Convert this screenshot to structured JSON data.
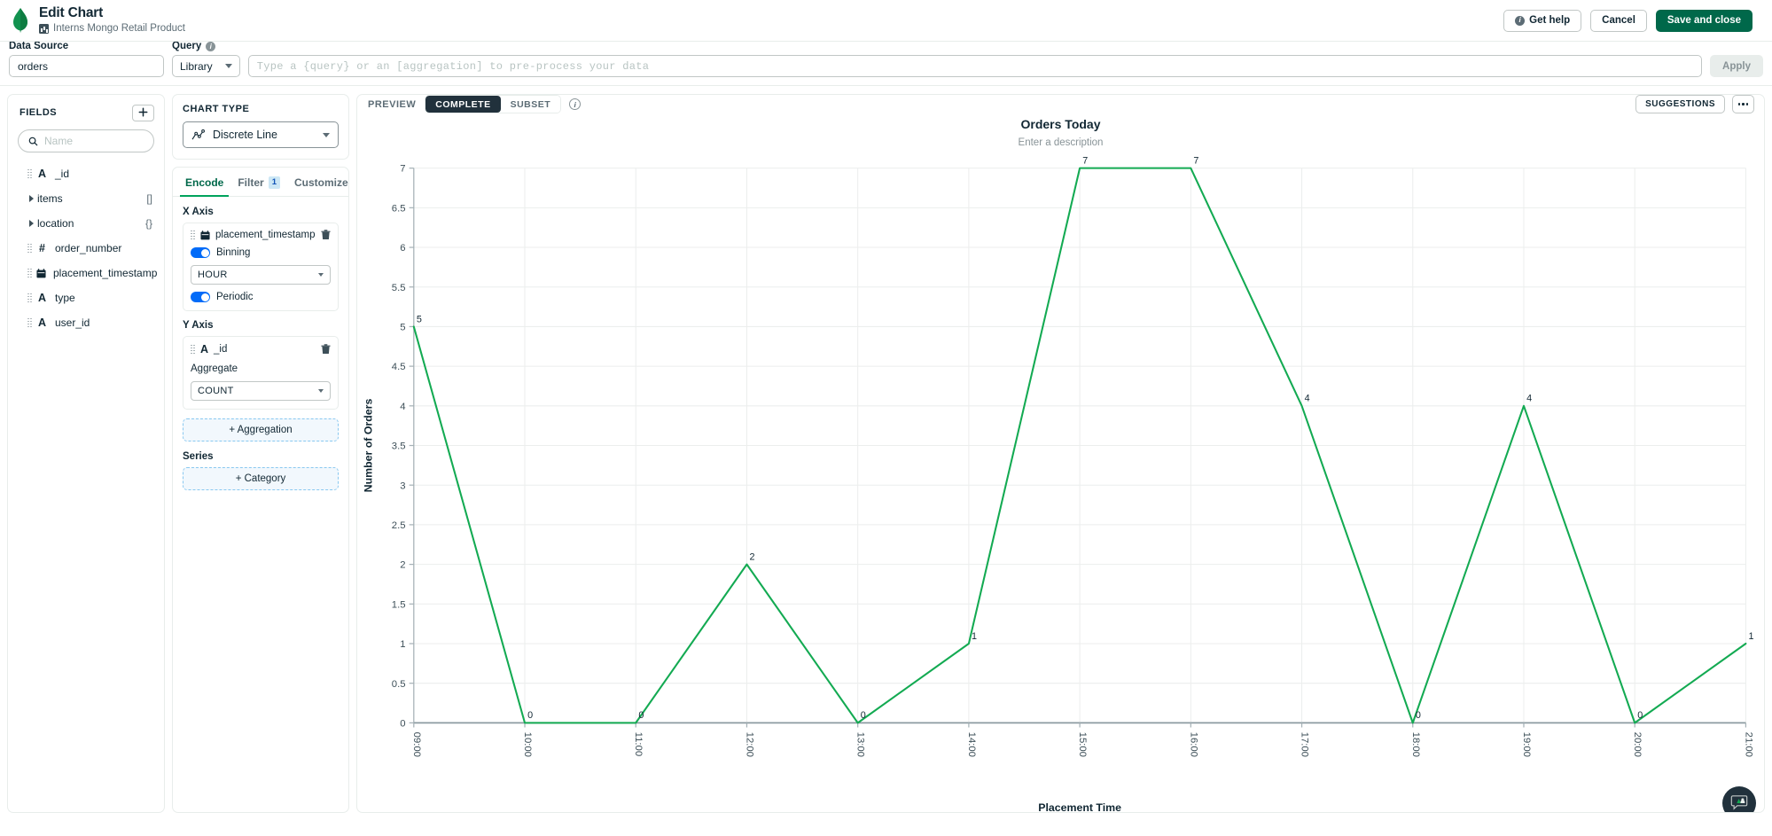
{
  "topbar": {
    "logo_icon": "mongodb-leaf-icon",
    "title": "Edit Chart",
    "dashboard_icon": "chart-badge-icon",
    "dashboard_name": "Interns Mongo Retail Product",
    "get_help_label": "Get help",
    "cancel_label": "Cancel",
    "save_label": "Save and close"
  },
  "querybar": {
    "data_source_label": "Data Source",
    "data_source_value": "orders",
    "query_label": "Query",
    "query_info_icon": "info-icon",
    "library_label": "Library",
    "query_placeholder": "Type a {query} or an [aggregation] to pre-process your data",
    "apply_label": "Apply"
  },
  "fields": {
    "title": "FIELDS",
    "add_icon": "plus-icon",
    "search_icon": "search-icon",
    "search_placeholder": "Name",
    "items": [
      {
        "name": "_id",
        "type_glyph": "A",
        "kind": "string",
        "suffix": "",
        "expandable": false
      },
      {
        "name": "items",
        "type_glyph": "",
        "kind": "array",
        "suffix": "[]",
        "expandable": true
      },
      {
        "name": "location",
        "type_glyph": "",
        "kind": "object",
        "suffix": "{}",
        "expandable": true
      },
      {
        "name": "order_number",
        "type_glyph": "#",
        "kind": "number",
        "suffix": "",
        "expandable": false
      },
      {
        "name": "placement_timestamp",
        "type_glyph": "cal",
        "kind": "date",
        "suffix": "",
        "expandable": false
      },
      {
        "name": "type",
        "type_glyph": "A",
        "kind": "string",
        "suffix": "",
        "expandable": false
      },
      {
        "name": "user_id",
        "type_glyph": "A",
        "kind": "string",
        "suffix": "",
        "expandable": false
      }
    ]
  },
  "encode": {
    "chart_type_label": "CHART TYPE",
    "chart_type_icon": "line-chart-icon",
    "chart_type_value": "Discrete Line",
    "tabs": [
      {
        "label": "Encode",
        "active": true,
        "badge": ""
      },
      {
        "label": "Filter",
        "active": false,
        "badge": "1"
      },
      {
        "label": "Customize",
        "active": false,
        "badge": ""
      }
    ],
    "x_axis": {
      "label": "X Axis",
      "field_icon": "calendar-icon",
      "field_name": "placement_timestamp",
      "delete_icon": "trash-icon",
      "binning_label": "Binning",
      "binning_on": true,
      "bin_unit": "HOUR",
      "periodic_label": "Periodic",
      "periodic_on": true
    },
    "y_axis": {
      "label": "Y Axis",
      "field_icon": "string-type-icon",
      "field_name": "_id",
      "delete_icon": "trash-icon",
      "aggregate_label": "Aggregate",
      "aggregate_value": "COUNT",
      "add_aggregation_label": "+ Aggregation"
    },
    "series": {
      "label": "Series",
      "add_category_label": "+ Category"
    }
  },
  "chart_toolbar": {
    "preview_label": "PREVIEW",
    "segments": [
      {
        "label": "COMPLETE",
        "active": true
      },
      {
        "label": "SUBSET",
        "active": false
      }
    ],
    "info_icon": "info-icon",
    "suggestions_label": "SUGGESTIONS",
    "more_icon": "ellipsis-icon"
  },
  "chat": {
    "icon": "chat-feedback-icon"
  },
  "colors": {
    "brand_green": "#00684a",
    "line_green": "#13aa52",
    "accent": "#00a35c",
    "dark": "#21313c",
    "toggle_blue": "#016bf8"
  },
  "chart_data": {
    "type": "line",
    "title": "Orders Today",
    "subtitle": "Enter a description",
    "xlabel": "Placement Time",
    "ylabel": "Number of Orders",
    "categories": [
      "09:00",
      "10:00",
      "11:00",
      "12:00",
      "13:00",
      "14:00",
      "15:00",
      "16:00",
      "17:00",
      "18:00",
      "19:00",
      "20:00",
      "21:00"
    ],
    "values": [
      5,
      0,
      0,
      2,
      0,
      1,
      7,
      7,
      4,
      0,
      4,
      0,
      1
    ],
    "data_labels": [
      "5",
      "0",
      "0",
      "2",
      "0",
      "1",
      "7",
      "7",
      "4",
      "0",
      "4",
      "0",
      "1"
    ],
    "ylim": [
      0,
      7
    ],
    "yticks": [
      0,
      0.5,
      1,
      1.5,
      2,
      2.5,
      3,
      3.5,
      4,
      4.5,
      5,
      5.5,
      6,
      6.5,
      7
    ],
    "ytick_labels": [
      "0",
      "0.5",
      "1",
      "1.5",
      "2",
      "2.5",
      "3",
      "3.5",
      "4",
      "4.5",
      "5",
      "5.5",
      "6",
      "6.5",
      "7"
    ],
    "grid": true,
    "legend": "none",
    "series_color": "#13aa52"
  }
}
